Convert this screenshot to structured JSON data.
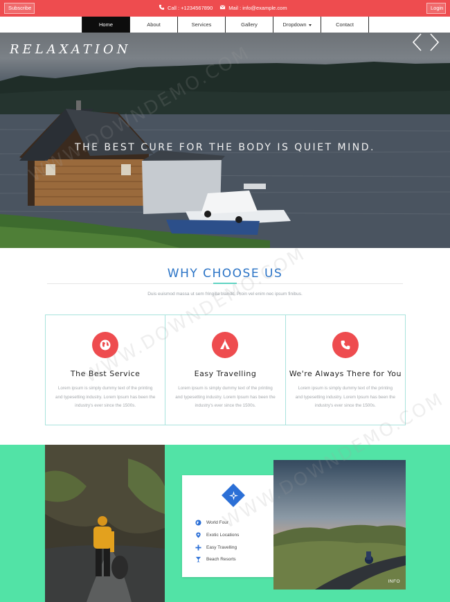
{
  "topbar": {
    "subscribe_label": "Subscribe",
    "phone": "Call : +1234567890",
    "mail": "Mail : info@example.com",
    "login_label": "Login"
  },
  "nav": {
    "items": [
      "Home",
      "About",
      "Services",
      "Gallery",
      "Dropdown",
      "Contact"
    ],
    "active": "Home"
  },
  "hero": {
    "logo": "RELAXATION",
    "tagline": "THE BEST CURE FOR THE BODY IS QUIET MIND."
  },
  "why": {
    "title": "WHY CHOOSE US",
    "subtitle": "Duis euismod massa ut sem fringilla blandit. Proin vel enim nec ipsum finibus.",
    "cards": [
      {
        "title": "The Best Service",
        "text": "Lorem ipsum is simply dummy text of the printing and typesetting industry. Lorem Ipsum has been the industry's ever since the 1500s.",
        "icon": "globe-icon"
      },
      {
        "title": "Easy Travelling",
        "text": "Lorem ipsum is simply dummy text of the printing and typesetting industry. Lorem Ipsum has been the industry's ever since the 1500s.",
        "icon": "tent-icon"
      },
      {
        "title": "We're Always There for You",
        "text": "Lorem ipsum is simply dummy text of the printing and typesetting industry. Lorem Ipsum has been the industry's ever since the 1500s.",
        "icon": "phone-icon"
      }
    ]
  },
  "info": {
    "items": [
      "World Four",
      "Exotic Locations",
      "Easy Travelling",
      "Beach Resorts"
    ],
    "photo_label": "INFO"
  },
  "watermark": "WWW.DOWNDEMO.COM",
  "colors": {
    "accent_red": "#ee4c4f",
    "accent_blue": "#2a73c6",
    "band_green": "#52e3a6"
  }
}
